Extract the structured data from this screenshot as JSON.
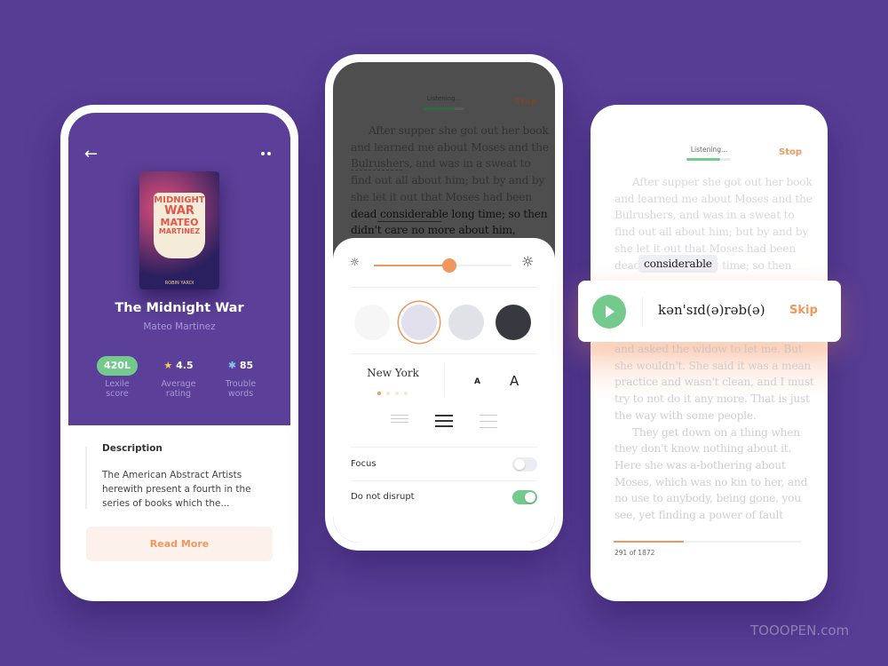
{
  "colors": {
    "background": "#573d94",
    "accent": "#f0975e",
    "green": "#74c98d",
    "purple": "#5b3f98"
  },
  "book_screen": {
    "back_icon": "arrow-left-icon",
    "more_icon": "more-dots-icon",
    "cover": {
      "title_top": "MIDNIGHT",
      "title_mid": "WAR",
      "author_1": "MATEO",
      "author_2": "MARTINEZ",
      "illustrator": "ROBIN YARDI"
    },
    "title": "The Midnight War",
    "author": "Mateo Martinez",
    "stats": [
      {
        "value": "420L",
        "label_1": "Lexile",
        "label_2": "score"
      },
      {
        "icon": "star-icon",
        "value": "4.5",
        "label_1": "Average",
        "label_2": "rating"
      },
      {
        "icon": "asterisk-icon",
        "value": "85",
        "label_1": "Trouble",
        "label_2": "words"
      }
    ],
    "description_heading": "Description",
    "description": [
      "The American Abstract Artists",
      "herewith present a fourth in the",
      "series of books which the..."
    ],
    "read_more": "Read More"
  },
  "settings_screen": {
    "listening": "Listening...",
    "stop": "Stop",
    "listening_progress": 0.75,
    "text": [
      "After supper she got out her book",
      "and learned me about Moses and the",
      "Bulrushers, and was in a sweat to",
      "find out all about him; but by and by",
      "she let it out that Moses had been",
      "dead considerable long time; so then",
      "didn't care no more about him,"
    ],
    "brightness": 0.55,
    "themes": [
      "#f6f6f7",
      "#e1e0ec",
      "#e1e2e8",
      "#383840"
    ],
    "selected_theme": 1,
    "font_name": "New York",
    "font_pages": 4,
    "font_page_active": 0,
    "font_small": "A",
    "font_large": "A",
    "spacing_options": [
      "compact",
      "normal",
      "wide"
    ],
    "selected_spacing": 1,
    "focus_label": "Focus",
    "focus_on": false,
    "disrupt_label": "Do not disrupt",
    "disrupt_on": true
  },
  "pronounce_screen": {
    "listening": "Listening...",
    "stop": "Stop",
    "listening_progress": 0.75,
    "text_top": [
      "After supper she got out her book",
      "and learned me about Moses and the",
      "Bulrushers, and was in a sweat to",
      "find out all about him; but by and by",
      "she let it out that Moses had been"
    ],
    "dead": "dead",
    "word": "considerable",
    "after_word": "ong time; so then",
    "phonetic": "kən'sɪd(ə)rəb(ə)",
    "skip": "Skip",
    "text_bottom": [
      "and asked the widow to let me. But",
      "she wouldn't. She said it was a mean",
      "practice and wasn't clean, and I must",
      "try to not do it any more. That is just",
      "the way with some people.",
      "They get down on a thing when",
      "they don't know nothing about it.",
      "Here she was a-bothering about",
      "Moses, which was no kin to her, and",
      "no use to anybody, being gone, you",
      "see, yet finding a power of fault"
    ],
    "page_label": "291 of 1872",
    "page": 291,
    "total_pages": 1872
  },
  "watermark": "TOOOPEN.com"
}
